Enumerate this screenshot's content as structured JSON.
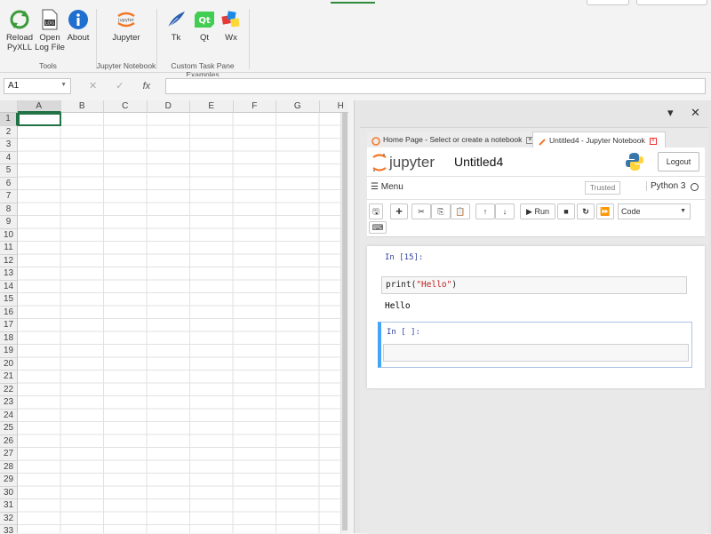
{
  "ribbon": {
    "buttons": {
      "reload": "Reload PyXLL",
      "open_log": "Open Log File",
      "about": "About",
      "jupyter": "Jupyter",
      "tk": "Tk",
      "qt": "Qt",
      "wx": "Wx"
    },
    "groups": {
      "tools": "Tools",
      "jupyter_notebook": "Jupyter Notebook",
      "custom_task_pane": "Custom Task Pane Examples"
    }
  },
  "formula_bar": {
    "name_box": "A1",
    "cancel_glyph": "✕",
    "enter_glyph": "✓",
    "fx_glyph": "fx"
  },
  "grid": {
    "columns": [
      "A",
      "B",
      "C",
      "D",
      "E",
      "F",
      "G",
      "H"
    ],
    "rows": [
      "1",
      "2",
      "3",
      "4",
      "5",
      "6",
      "7",
      "8",
      "9",
      "10",
      "11",
      "12",
      "13",
      "14",
      "15",
      "16",
      "17",
      "18",
      "19",
      "20",
      "21",
      "22",
      "23",
      "24",
      "25",
      "26",
      "27",
      "28",
      "29",
      "30",
      "31",
      "32",
      "33"
    ],
    "selected_cell": "A1"
  },
  "pane": {
    "close_glyph": "✕",
    "options_glyph": "▾"
  },
  "jupyter": {
    "tabs": [
      {
        "label": "Home Page - Select or create a notebook",
        "active": false
      },
      {
        "label": "Untitled4 - Jupyter Notebook",
        "active": true
      }
    ],
    "logo_text": "jupyter",
    "notebook_title": "Untitled4",
    "logout_label": "Logout",
    "menu_label": "Menu",
    "trusted_label": "Trusted",
    "kernel_label": "Python 3",
    "run_label": "Run",
    "cell_type": "Code",
    "cells": [
      {
        "prompt": "In [15]:",
        "code_fn": "print(",
        "code_str": "\"Hello\"",
        "code_close": ")",
        "output": "Hello"
      },
      {
        "prompt": "In [ ]:",
        "code": ""
      }
    ]
  },
  "colors": {
    "excel_green": "#217346",
    "jupyter_orange": "#f37726",
    "active_cell_blue": "#42a5f5"
  }
}
